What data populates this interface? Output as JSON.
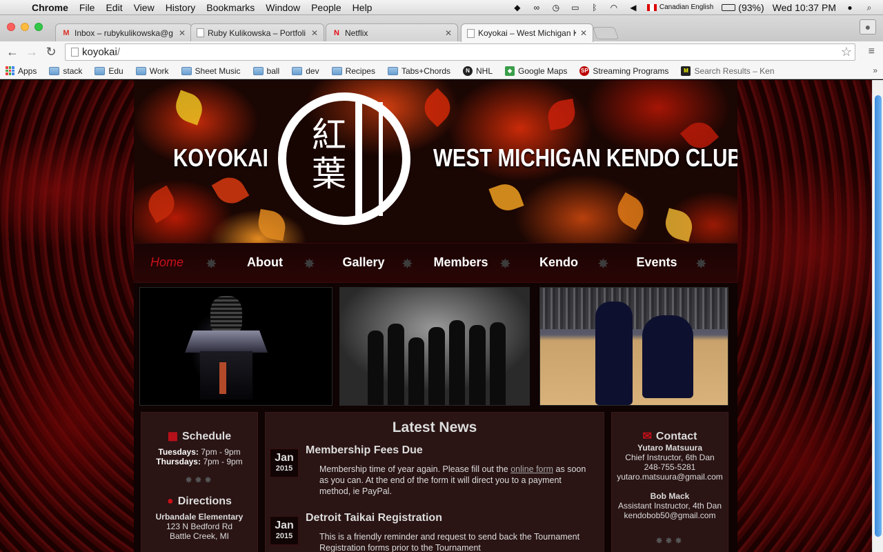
{
  "menubar": {
    "app_name": "Chrome",
    "items": [
      "File",
      "Edit",
      "View",
      "History",
      "Bookmarks",
      "Window",
      "People",
      "Help"
    ],
    "input_source": "Canadian English",
    "battery": "(93%)",
    "clock": "Wed 10:37 PM"
  },
  "tabs": [
    {
      "title": "Inbox – rubykulikowska@g",
      "favicon": "gmail-icon"
    },
    {
      "title": "Ruby Kulikowska – Portfoli",
      "favicon": "page-icon"
    },
    {
      "title": "Netflix",
      "favicon": "netflix-icon"
    },
    {
      "title": "Koyokai – West Michigan K",
      "favicon": "page-icon",
      "active": true
    }
  ],
  "omnibox": {
    "host": "koyokai",
    "path": "/"
  },
  "bookmarks": [
    "Apps",
    "stack",
    "Edu",
    "Work",
    "Sheet Music",
    "ball",
    "dev",
    "Recipes",
    "Tabs+Chords",
    "NHL",
    "Google Maps",
    "Streaming Programs",
    "Search Results – Ken"
  ],
  "banner": {
    "left": "KOYOKAI",
    "right": "WEST MICHIGAN KENDO CLUB",
    "kanji_top": "紅",
    "kanji_bottom": "葉"
  },
  "nav": [
    "Home",
    "About",
    "Gallery",
    "Members",
    "Kendo",
    "Events"
  ],
  "schedule": {
    "title": "Schedule",
    "rows": [
      {
        "day": "Tuesdays:",
        "time": "7pm - 9pm"
      },
      {
        "day": "Thursdays:",
        "time": "7pm - 9pm"
      }
    ]
  },
  "directions": {
    "title": "Directions",
    "place": "Urbandale Elementary",
    "street": "123 N Bedford Rd",
    "city": "Battle Creek, MI"
  },
  "news": {
    "title": "Latest News",
    "items": [
      {
        "month": "Jan",
        "year": "2015",
        "headline": "Membership Fees Due",
        "text_before": "Membership time of year again. Please fill out the ",
        "link": "online form",
        "text_after": " as soon as you can. At the end of the form it will direct you to a payment method, ie PayPal."
      },
      {
        "month": "Jan",
        "year": "2015",
        "headline": "Detroit Taikai Registration",
        "text_before": "This is a friendly reminder and request to send back the Tournament Registration forms prior to the Tournament",
        "link": "",
        "text_after": ""
      }
    ]
  },
  "contact": {
    "title": "Contact",
    "people": [
      {
        "name": "Yutaro Matsuura",
        "role": "Chief Instructor, 6th Dan",
        "phone": "248-755-5281",
        "email": "yutaro.matsuura@gmail.com"
      },
      {
        "name": "Bob Mack",
        "role": "Assistant Instructor, 4th Dan",
        "email": "kendobob50@gmail.com"
      }
    ]
  }
}
